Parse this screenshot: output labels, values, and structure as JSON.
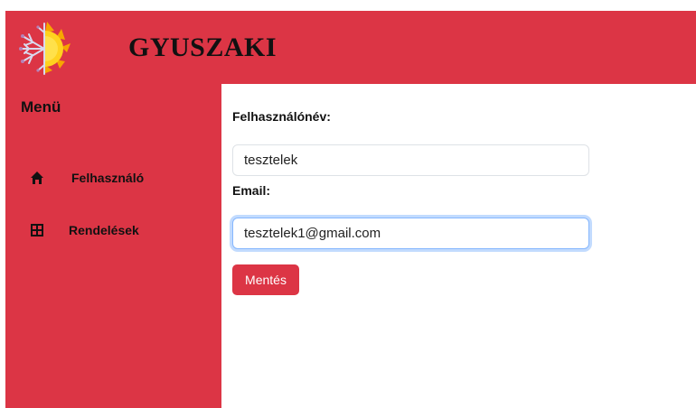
{
  "header": {
    "brand": "GYUSZAKI",
    "logo_icon": "sun-snowflake-logo-icon"
  },
  "sidebar": {
    "title": "Menü",
    "items": [
      {
        "label": "Felhasználó",
        "icon": "home-icon"
      },
      {
        "label": "Rendelések",
        "icon": "grid-icon"
      }
    ]
  },
  "form": {
    "username_label": "Felhasználónév:",
    "username_value": "tesztelek",
    "email_label": "Email:",
    "email_value": "tesztelek1@gmail.com",
    "save_label": "Mentés"
  },
  "colors": {
    "accent": "#dc3545",
    "focus": "#86b7fe"
  }
}
